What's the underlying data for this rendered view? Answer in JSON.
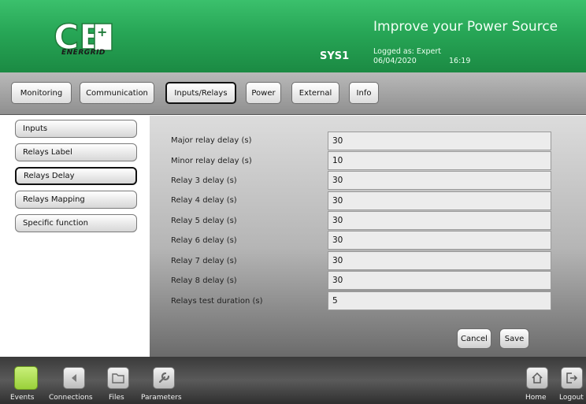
{
  "header": {
    "logo_text": "CE+T",
    "logo_sub": "ENERGRID",
    "tagline": "Improve your Power Source",
    "system": "SYS1",
    "logged_as": "Logged as: Expert",
    "date": "06/04/2020",
    "time": "16:19"
  },
  "tabs": [
    {
      "label": "Monitoring"
    },
    {
      "label": "Communication"
    },
    {
      "label": "Inputs/Relays"
    },
    {
      "label": "Power"
    },
    {
      "label": "External"
    },
    {
      "label": "Info"
    }
  ],
  "active_tab": "Inputs/Relays",
  "side_menu": [
    {
      "label": "Inputs"
    },
    {
      "label": "Relays Label"
    },
    {
      "label": "Relays Delay"
    },
    {
      "label": "Relays Mapping"
    },
    {
      "label": "Specific function"
    }
  ],
  "active_side": "Relays Delay",
  "fields": [
    {
      "label": "Major relay delay (s)",
      "value": "30"
    },
    {
      "label": "Minor relay delay (s)",
      "value": "10"
    },
    {
      "label": "Relay 3 delay (s)",
      "value": "30"
    },
    {
      "label": "Relay 4 delay (s)",
      "value": "30"
    },
    {
      "label": "Relay 5 delay (s)",
      "value": "30"
    },
    {
      "label": "Relay 6 delay (s)",
      "value": "30"
    },
    {
      "label": "Relay 7 delay (s)",
      "value": "30"
    },
    {
      "label": "Relay 8 delay (s)",
      "value": "30"
    },
    {
      "label": "Relays test duration (s)",
      "value": "5"
    }
  ],
  "buttons": {
    "cancel": "Cancel",
    "save": "Save"
  },
  "bottom_nav": [
    {
      "label": "Events",
      "icon": "events-icon"
    },
    {
      "label": "Connections",
      "icon": "connections-icon"
    },
    {
      "label": "Files",
      "icon": "folder-icon"
    },
    {
      "label": "Parameters",
      "icon": "wrench-icon"
    },
    {
      "label": "Home",
      "icon": "home-icon"
    },
    {
      "label": "Logout",
      "icon": "logout-icon"
    }
  ],
  "colors": {
    "header_green": "#27a656",
    "events_green": "#b5e35a"
  }
}
